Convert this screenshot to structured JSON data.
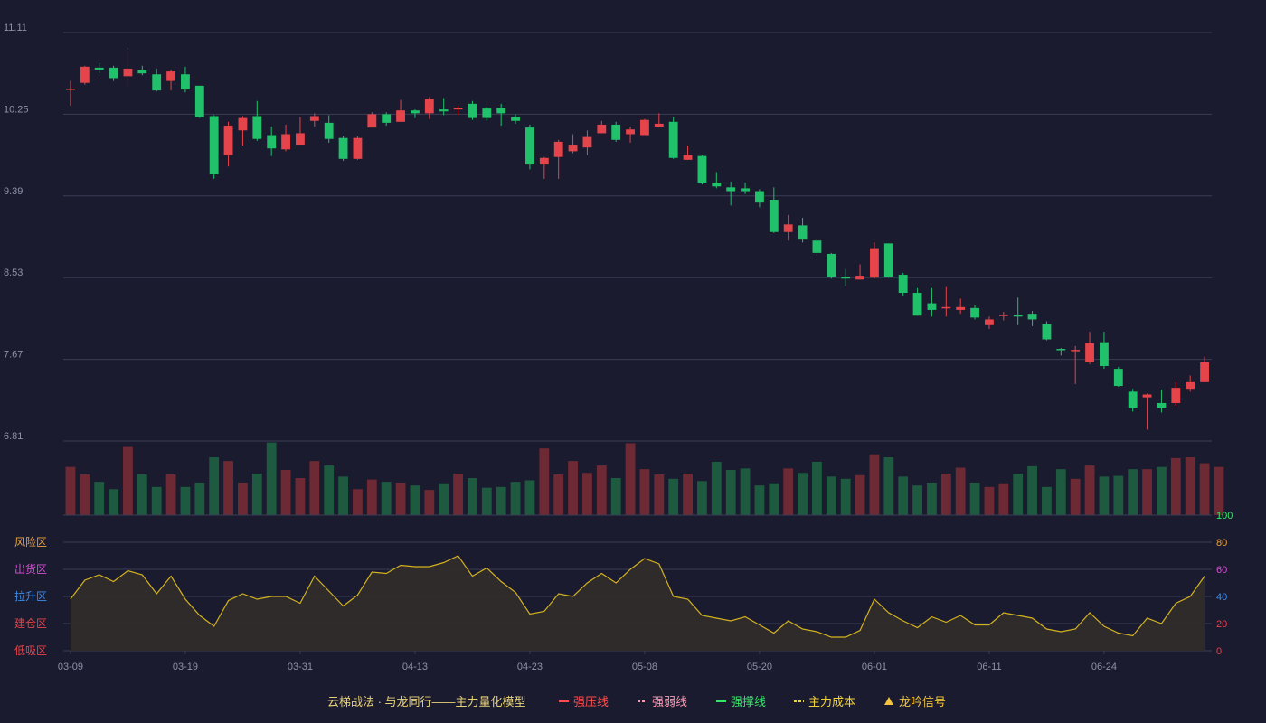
{
  "chart_data": [
    {
      "type": "candlestick",
      "price_axis": {
        "ticks": [
          11.11,
          10.25,
          9.39,
          8.53,
          7.67,
          6.81
        ],
        "range": [
          6.81,
          11.11
        ]
      },
      "x_tick_labels": [
        {
          "index": 0,
          "label": "03-09"
        },
        {
          "index": 8,
          "label": "03-19"
        },
        {
          "index": 16,
          "label": "03-31"
        },
        {
          "index": 24,
          "label": "04-13"
        },
        {
          "index": 32,
          "label": "04-23"
        },
        {
          "index": 40,
          "label": "05-08"
        },
        {
          "index": 48,
          "label": "05-20"
        },
        {
          "index": 56,
          "label": "06-01"
        },
        {
          "index": 64,
          "label": "06-11"
        },
        {
          "index": 72,
          "label": "06-24"
        }
      ],
      "candles": [
        [
          10.52,
          10.52,
          10.34,
          10.6
        ],
        [
          10.58,
          10.75,
          10.56,
          10.76
        ],
        [
          10.74,
          10.72,
          10.68,
          10.79
        ],
        [
          10.74,
          10.63,
          10.6,
          10.76
        ],
        [
          10.65,
          10.73,
          10.54,
          10.95
        ],
        [
          10.72,
          10.68,
          10.66,
          10.76
        ],
        [
          10.67,
          10.5,
          10.49,
          10.73
        ],
        [
          10.6,
          10.7,
          10.5,
          10.72
        ],
        [
          10.67,
          10.51,
          10.48,
          10.75
        ],
        [
          10.55,
          10.22,
          10.21,
          10.55
        ],
        [
          10.23,
          9.62,
          9.57,
          10.24
        ],
        [
          9.82,
          10.13,
          9.7,
          10.17
        ],
        [
          10.08,
          10.21,
          9.92,
          10.23
        ],
        [
          10.23,
          9.99,
          9.97,
          10.39
        ],
        [
          10.03,
          9.89,
          9.81,
          10.12
        ],
        [
          9.88,
          10.04,
          9.86,
          10.14
        ],
        [
          9.93,
          10.05,
          9.93,
          10.22
        ],
        [
          10.18,
          10.23,
          10.12,
          10.26
        ],
        [
          10.16,
          9.99,
          9.95,
          10.24
        ],
        [
          10.0,
          9.78,
          9.76,
          10.02
        ],
        [
          9.78,
          10.0,
          9.77,
          10.02
        ],
        [
          10.11,
          10.25,
          10.11,
          10.27
        ],
        [
          10.25,
          10.16,
          10.13,
          10.27
        ],
        [
          10.17,
          10.29,
          10.17,
          10.4
        ],
        [
          10.29,
          10.26,
          10.21,
          10.3
        ],
        [
          10.26,
          10.41,
          10.2,
          10.43
        ],
        [
          10.3,
          10.28,
          10.24,
          10.42
        ],
        [
          10.3,
          10.32,
          10.24,
          10.34
        ],
        [
          10.36,
          10.21,
          10.19,
          10.39
        ],
        [
          10.31,
          10.21,
          10.18,
          10.33
        ],
        [
          10.32,
          10.26,
          10.13,
          10.36
        ],
        [
          10.22,
          10.18,
          10.15,
          10.25
        ],
        [
          10.11,
          9.72,
          9.67,
          10.14
        ],
        [
          9.72,
          9.79,
          9.57,
          9.8
        ],
        [
          9.8,
          9.96,
          9.57,
          9.98
        ],
        [
          9.86,
          9.93,
          9.84,
          10.04
        ],
        [
          9.9,
          10.01,
          9.82,
          10.08
        ],
        [
          10.05,
          10.14,
          10.05,
          10.18
        ],
        [
          10.14,
          9.98,
          9.96,
          10.17
        ],
        [
          10.04,
          10.09,
          9.95,
          10.12
        ],
        [
          10.03,
          10.19,
          10.03,
          10.2
        ],
        [
          10.12,
          10.15,
          10.11,
          10.26
        ],
        [
          10.17,
          9.79,
          9.78,
          10.22
        ],
        [
          9.77,
          9.82,
          9.77,
          9.92
        ],
        [
          9.81,
          9.53,
          9.51,
          9.82
        ],
        [
          9.53,
          9.49,
          9.47,
          9.64
        ],
        [
          9.48,
          9.44,
          9.29,
          9.54
        ],
        [
          9.47,
          9.44,
          9.41,
          9.53
        ],
        [
          9.44,
          9.32,
          9.27,
          9.46
        ],
        [
          9.35,
          9.01,
          9.0,
          9.48
        ],
        [
          9.01,
          9.09,
          8.92,
          9.19
        ],
        [
          9.08,
          8.93,
          8.9,
          9.16
        ],
        [
          8.92,
          8.79,
          8.76,
          8.94
        ],
        [
          8.78,
          8.54,
          8.52,
          8.79
        ],
        [
          8.54,
          8.52,
          8.44,
          8.62
        ],
        [
          8.51,
          8.55,
          8.51,
          8.67
        ],
        [
          8.53,
          8.84,
          8.52,
          8.9
        ],
        [
          8.89,
          8.54,
          8.53,
          8.89
        ],
        [
          8.56,
          8.37,
          8.34,
          8.58
        ],
        [
          8.37,
          8.13,
          8.13,
          8.42
        ],
        [
          8.26,
          8.19,
          8.12,
          8.42
        ],
        [
          8.22,
          8.22,
          8.12,
          8.43
        ],
        [
          8.19,
          8.22,
          8.15,
          8.31
        ],
        [
          8.21,
          8.11,
          8.09,
          8.24
        ],
        [
          8.03,
          8.09,
          7.99,
          8.12
        ],
        [
          8.13,
          8.14,
          8.08,
          8.17
        ],
        [
          8.14,
          8.12,
          8.03,
          8.32
        ],
        [
          8.15,
          8.09,
          8.02,
          8.18
        ],
        [
          8.04,
          7.88,
          7.87,
          8.07
        ],
        [
          7.78,
          7.77,
          7.71,
          7.79
        ],
        [
          7.76,
          7.77,
          7.41,
          7.81
        ],
        [
          7.64,
          7.84,
          7.62,
          7.96
        ],
        [
          7.85,
          7.6,
          7.57,
          7.96
        ],
        [
          7.57,
          7.39,
          7.38,
          7.59
        ],
        [
          7.33,
          7.16,
          7.12,
          7.36
        ],
        [
          7.27,
          7.3,
          6.93,
          7.31
        ],
        [
          7.21,
          7.16,
          7.11,
          7.35
        ],
        [
          7.21,
          7.37,
          7.18,
          7.43
        ],
        [
          7.36,
          7.43,
          7.33,
          7.5
        ],
        [
          7.43,
          7.64,
          7.43,
          7.7
        ]
      ]
    },
    {
      "type": "bar",
      "name": "volume",
      "volume_max": 100,
      "values": [
        65,
        55,
        45,
        35,
        92,
        55,
        38,
        55,
        38,
        44,
        78,
        73,
        44,
        56,
        98,
        61,
        50,
        73,
        67,
        52,
        35,
        48,
        45,
        44,
        40,
        34,
        43,
        56,
        50,
        37,
        38,
        45,
        47,
        90,
        55,
        73,
        57,
        67,
        50,
        97,
        62,
        55,
        49,
        56,
        46,
        72,
        61,
        63,
        40,
        43,
        63,
        57,
        72,
        52,
        49,
        54,
        82,
        78,
        52,
        40,
        44,
        56,
        64,
        44,
        38,
        43,
        56,
        66,
        38,
        62,
        49,
        67,
        52,
        53,
        62,
        62,
        65,
        77,
        78,
        70,
        65
      ]
    },
    {
      "type": "area",
      "name": "主力量化模型",
      "ylim": [
        0,
        100
      ],
      "y_ticks": [
        100,
        80,
        60,
        40,
        20,
        0
      ],
      "values": [
        38,
        52,
        56,
        51,
        59,
        56,
        42,
        55,
        38,
        26,
        18,
        37,
        42,
        38,
        40,
        40,
        35,
        55,
        44,
        33,
        41,
        58,
        57,
        63,
        62,
        62,
        65,
        70,
        55,
        61,
        51,
        43,
        27,
        29,
        42,
        40,
        50,
        57,
        50,
        60,
        68,
        64,
        40,
        38,
        26,
        24,
        22,
        25,
        19,
        13,
        22,
        16,
        14,
        10,
        10,
        15,
        38,
        28,
        22,
        17,
        25,
        21,
        26,
        19,
        19,
        28,
        26,
        24,
        16,
        14,
        16,
        28,
        18,
        13,
        11,
        24,
        20,
        35,
        40,
        55
      ]
    }
  ],
  "zones": [
    {
      "label": "风险区",
      "color": "#e8a23c"
    },
    {
      "label": "出货区",
      "color": "#d44fd1"
    },
    {
      "label": "拉升区",
      "color": "#3d8be8"
    },
    {
      "label": "建仓区",
      "color": "#e5444a"
    },
    {
      "label": "低吸区",
      "color": "#e5444a"
    }
  ],
  "tick_colors": {
    "100": "#39e36a",
    "80": "#e8a23c",
    "60": "#d44fd1",
    "40": "#3d8be8",
    "20": "#e5444a",
    "0": "#e5444a"
  },
  "legend": {
    "title": "云梯战法 · 与龙同行——主力量化模型",
    "title_color": "#e8d27a",
    "items": [
      {
        "label": "强压线",
        "color": "#ff4d4f",
        "style": "solid"
      },
      {
        "label": "强弱线",
        "color": "#ff9ab3",
        "style": "dashed"
      },
      {
        "label": "强撑线",
        "color": "#39e36a",
        "style": "solid"
      },
      {
        "label": "主力成本",
        "color": "#f2d33c",
        "style": "dashed"
      },
      {
        "label": "龙吟信号",
        "color": "#f2c33c",
        "style": "triangle"
      }
    ]
  },
  "colors": {
    "up": "#e5444a",
    "down": "#21c06b",
    "volume_up": "#6e2a34",
    "volume_down": "#1e5a40",
    "grid": "#3a3d55",
    "area_line": "#d4b21f",
    "area_fill": "#2f2c2a",
    "background": "#1a1b2e"
  }
}
